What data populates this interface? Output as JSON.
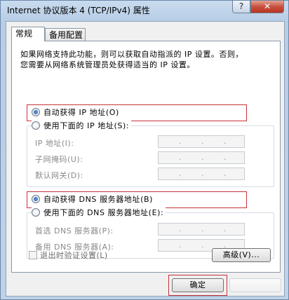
{
  "window": {
    "title": "Internet 协议版本 4 (TCP/IPv4) 属性",
    "help_label": "?",
    "close_label": "✕"
  },
  "tabs": [
    {
      "label": "常规",
      "active": true
    },
    {
      "label": "备用配置",
      "active": false
    }
  ],
  "description": {
    "line1": "如果网络支持此功能，则可以获取自动指派的 IP 设置。否则，",
    "line2": "您需要从网络系统管理员处获得适当的 IP 设置。"
  },
  "ip_section": {
    "auto_label": "自动获得 IP 地址(O)",
    "auto_selected": true,
    "manual_label": "使用下面的 IP 地址(S):",
    "manual_selected": false,
    "fields": [
      {
        "label": "IP 地址(I):"
      },
      {
        "label": "子网掩码(U):"
      },
      {
        "label": "默认网关(D):"
      }
    ]
  },
  "dns_section": {
    "auto_label": "自动获得 DNS 服务器地址(B)",
    "auto_selected": true,
    "manual_label": "使用下面的 DNS 服务器地址(E):",
    "manual_selected": false,
    "fields": [
      {
        "label": "首选 DNS 服务器(P):"
      },
      {
        "label": "备用 DNS 服务器(A):"
      }
    ]
  },
  "validate_on_exit": {
    "label": "退出时验证设置(L)",
    "checked": false
  },
  "buttons": {
    "advanced": "高级(V)...",
    "ok": "确定"
  },
  "ip_dot": "."
}
